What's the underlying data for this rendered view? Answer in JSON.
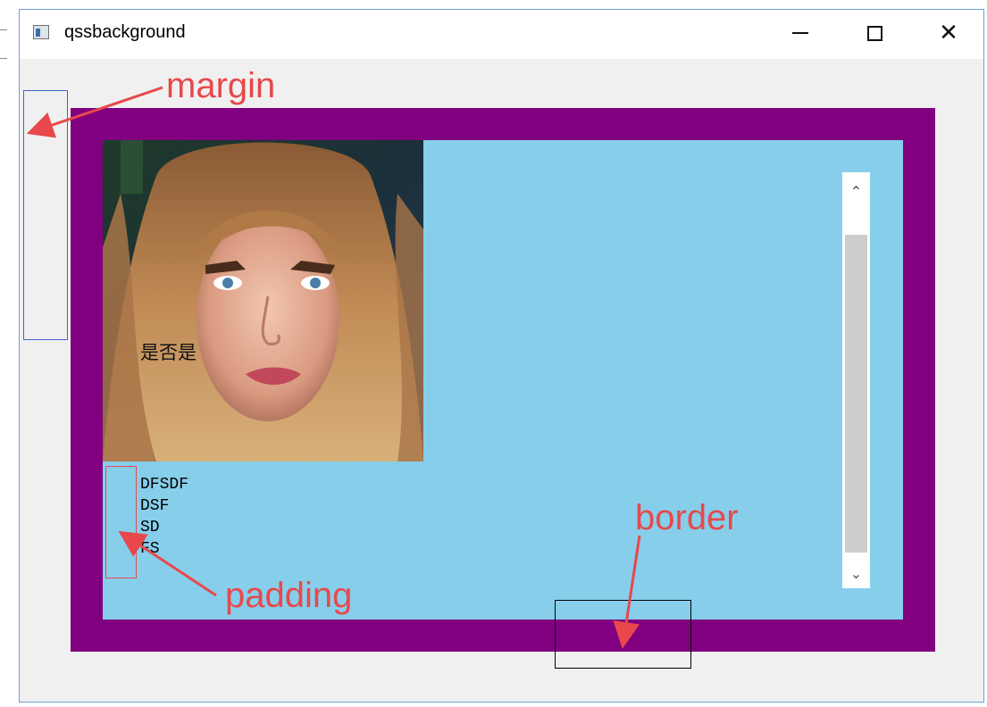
{
  "window": {
    "title": "qssbackground",
    "controls": {
      "minimize_icon": "minimize-icon",
      "maximize_icon": "maximize-icon",
      "close_icon": "close-icon"
    }
  },
  "widget": {
    "border_color": "#800080",
    "background_color": "#87ceeb",
    "photo_caption": "是否是",
    "text_lines": [
      "DFSDF",
      "DSF",
      "SD",
      "FS"
    ]
  },
  "annotations": {
    "margin_label": "margin",
    "border_label": "border",
    "padding_label": "padding",
    "label_color": "#e8484b"
  }
}
